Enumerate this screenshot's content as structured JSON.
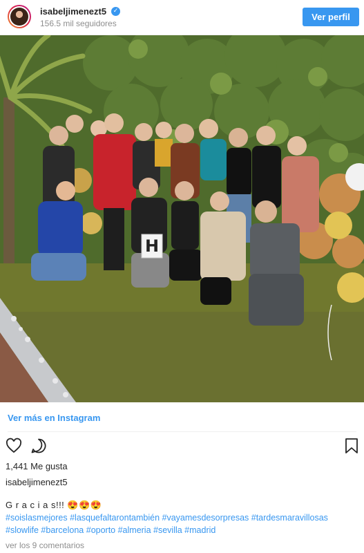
{
  "header": {
    "username": "isabeljimenezt5",
    "verified_icon": "verified-badge-icon",
    "followers": "156.5 mil seguidores",
    "view_profile_label": "Ver perfil"
  },
  "photo": {
    "letter_sign": "H"
  },
  "links": {
    "view_more": "Ver más en Instagram"
  },
  "actions": {
    "like_icon": "heart-icon",
    "comment_icon": "comment-icon",
    "save_icon": "bookmark-icon"
  },
  "post": {
    "likes": "1,441 Me gusta",
    "caption_user": "isabeljimenezt5",
    "caption_text": "G r a c i a s!!! 😍😍😍",
    "hashtags_line1": "#soislasmejores #lasquefaltarontambién #vayamesdesorpresas #tardesmaravillosas",
    "hashtags_line2": "#slowlife #barcelona #oporto #almeria #sevilla #madrid",
    "comments": "ver los 9 comentarios"
  },
  "colors": {
    "accent": "#3897f0",
    "muted": "#8e8e8e",
    "text": "#262626"
  }
}
